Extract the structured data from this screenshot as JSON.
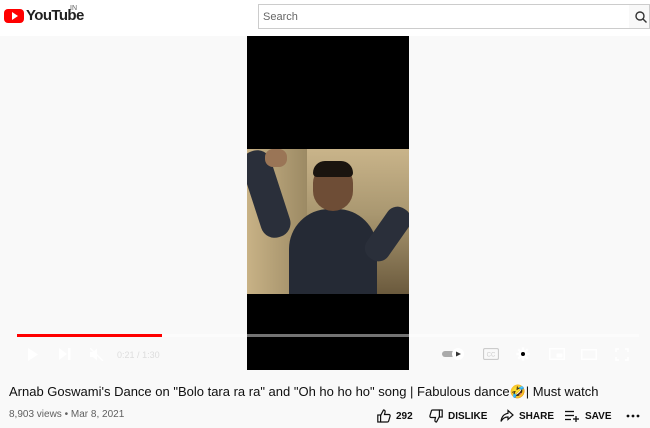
{
  "header": {
    "logo_text": "YouTube",
    "country_code": "IN",
    "search_placeholder": "Search"
  },
  "player": {
    "progress": 0.233,
    "time_current": "0:21",
    "time_separator": "/",
    "time_total": "1:30"
  },
  "video": {
    "title": "Arnab Goswami's Dance on \"Bolo tara ra ra\" and \"Oh ho ho ho\" song | Fabulous dance🤣| Must watch",
    "views": "8,903 views",
    "meta_separator": "•",
    "date": "Mar 8, 2021"
  },
  "actions": {
    "likes": "292",
    "dislike_label": "DISLIKE",
    "share_label": "SHARE",
    "save_label": "SAVE"
  },
  "colors": {
    "brand_red": "#ff0000",
    "text_primary": "#0f0f0f",
    "text_secondary": "#606060"
  }
}
